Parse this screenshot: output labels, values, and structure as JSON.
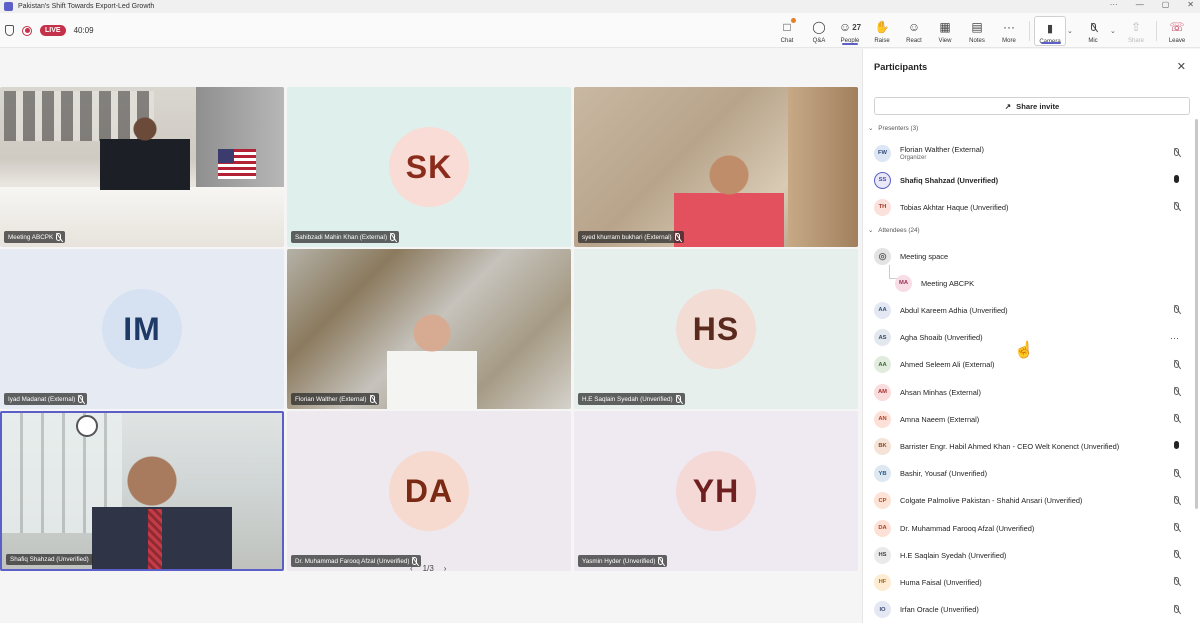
{
  "window": {
    "title": "Pakistan's Shift Towards Export-Led Growth",
    "controls": [
      "···",
      "—",
      "▢",
      "✕"
    ]
  },
  "meeting": {
    "live_label": "LIVE",
    "timer": "40:09"
  },
  "toolbar": {
    "buttons": [
      {
        "label": "Chat",
        "icon": "chat-icon"
      },
      {
        "label": "Q&A",
        "icon": "qa-icon"
      },
      {
        "label": "People",
        "icon": "people-icon",
        "count": "27"
      },
      {
        "label": "Raise",
        "icon": "hand-icon"
      },
      {
        "label": "React",
        "icon": "smile-icon"
      },
      {
        "label": "View",
        "icon": "grid-icon"
      },
      {
        "label": "Notes",
        "icon": "notes-icon"
      },
      {
        "label": "More",
        "icon": "more-icon"
      },
      {
        "label": "Camera",
        "icon": "camera-icon"
      },
      {
        "label": "Mic",
        "icon": "mic-off-icon"
      },
      {
        "label": "Share",
        "icon": "share-icon"
      },
      {
        "label": "Leave",
        "icon": "phone-hangup-icon"
      }
    ]
  },
  "tiles": [
    {
      "name": "Meeting ABCPK",
      "muted": true,
      "kind": "video"
    },
    {
      "name": "Sahibzadi Mahin Khan (External)",
      "muted": true,
      "kind": "avatar",
      "initials": "SK",
      "bg": "#f9dcd6",
      "fg": "#8a2c1c",
      "tile_bg": "#dff0ec"
    },
    {
      "name": "syed khurram bukhari (External)",
      "muted": true,
      "kind": "video"
    },
    {
      "name": "Iyad Madanat (External)",
      "muted": true,
      "kind": "avatar",
      "initials": "IM",
      "bg": "#d6e2f2",
      "fg": "#1f3a66",
      "tile_bg": "#e6ebf3"
    },
    {
      "name": "Florian Walther (External)",
      "muted": true,
      "kind": "video"
    },
    {
      "name": "H.E Saqlain Syedah (Unverified)",
      "muted": true,
      "kind": "avatar",
      "initials": "HS",
      "bg": "#f3dcd4",
      "fg": "#5a2a1e",
      "tile_bg": "#e7efec"
    },
    {
      "name": "Shafiq Shahzad (Unverified)",
      "muted": false,
      "kind": "video",
      "speaking": true
    },
    {
      "name": "Dr. Muhammad Farooq Afzal (Unverified)",
      "muted": true,
      "kind": "avatar",
      "initials": "DA",
      "bg": "#f7dacf",
      "fg": "#7a2a14",
      "tile_bg": "#eee8ef"
    },
    {
      "name": "Yasmin Hyder (Unverified)",
      "muted": true,
      "kind": "avatar",
      "initials": "YH",
      "bg": "#f4d9d6",
      "fg": "#6e1f1f",
      "tile_bg": "#efe9f2"
    }
  ],
  "pager": {
    "prev": "‹",
    "label": "1/3",
    "next": "›"
  },
  "panel": {
    "title": "Participants",
    "share_invite": "Share invite",
    "presenters_label": "Presenters (3)",
    "attendees_label": "Attendees (24)",
    "presenters": [
      {
        "initials": "FW",
        "name": "Florian Walther (External)",
        "sub": "Organizer",
        "mic": "off",
        "avatar_bg": "#dde6f4",
        "avatar_fg": "#2e4a7a"
      },
      {
        "initials": "SS",
        "name": "Shafiq Shahzad (Unverified)",
        "mic": "on",
        "bold": true,
        "avatar_bg": "#e8e8f6",
        "avatar_fg": "#4b4fa6",
        "outlined": true
      },
      {
        "initials": "TH",
        "name": "Tobias Akhtar Haque (Unverified)",
        "mic": "off",
        "avatar_bg": "#fbe0dc",
        "avatar_fg": "#a23a2a"
      }
    ],
    "attendees": [
      {
        "initials": "",
        "name": "Meeting space",
        "mic": "none",
        "avatar_bg": "#e3e3e3",
        "avatar_fg": "#666",
        "icon": "room-icon"
      },
      {
        "initials": "MA",
        "name": "Meeting ABCPK",
        "mic": "none",
        "avatar_bg": "#f8dde6",
        "avatar_fg": "#9a2f52",
        "indent": true
      },
      {
        "initials": "AA",
        "name": "Abdul Kareem Adhia (Unverified)",
        "mic": "off",
        "avatar_bg": "#e3e8f2",
        "avatar_fg": "#3c527a"
      },
      {
        "initials": "AS",
        "name": "Agha Shoaib (Unverified)",
        "mic": "more",
        "avatar_bg": "#e3e8ee",
        "avatar_fg": "#3b4c66"
      },
      {
        "initials": "AA",
        "name": "Ahmed Seleem Ali (External)",
        "mic": "off",
        "avatar_bg": "#e1ecdf",
        "avatar_fg": "#3f6a3a"
      },
      {
        "initials": "AM",
        "name": "Ahsan Minhas (External)",
        "mic": "off",
        "avatar_bg": "#fadcdc",
        "avatar_fg": "#a33030"
      },
      {
        "initials": "AN",
        "name": "Amna Naeem (External)",
        "mic": "off",
        "avatar_bg": "#fde0d8",
        "avatar_fg": "#b0402a"
      },
      {
        "initials": "BK",
        "name": "Barrister Engr. Habil Ahmed Khan - CEO Welt Konenct (Unverified)",
        "mic": "on",
        "avatar_bg": "#f5e3d8",
        "avatar_fg": "#8a4a2a"
      },
      {
        "initials": "YB",
        "name": "Bashir, Yousaf (Unverified)",
        "mic": "off",
        "avatar_bg": "#dde8f3",
        "avatar_fg": "#2e5a86"
      },
      {
        "initials": "CP",
        "name": "Colgate Palmolive Pakistan - Shahid Ansari (Unverified)",
        "mic": "off",
        "avatar_bg": "#fde2d6",
        "avatar_fg": "#b54a1e"
      },
      {
        "initials": "DA",
        "name": "Dr. Muhammad Farooq Afzal (Unverified)",
        "mic": "off",
        "avatar_bg": "#fde1d6",
        "avatar_fg": "#b04420"
      },
      {
        "initials": "HS",
        "name": "H.E Saqlain Syedah (Unverified)",
        "mic": "off",
        "avatar_bg": "#eaeaea",
        "avatar_fg": "#444"
      },
      {
        "initials": "HF",
        "name": "Huma Faisal (Unverified)",
        "mic": "off",
        "avatar_bg": "#fdecd2",
        "avatar_fg": "#a4661a"
      },
      {
        "initials": "IO",
        "name": "Irfan Oracle (Unverified)",
        "mic": "off",
        "avatar_bg": "#e4e8f2",
        "avatar_fg": "#3b4a72"
      }
    ]
  },
  "colors": {
    "accent": "#5b5fc7",
    "live": "#c4314b"
  }
}
